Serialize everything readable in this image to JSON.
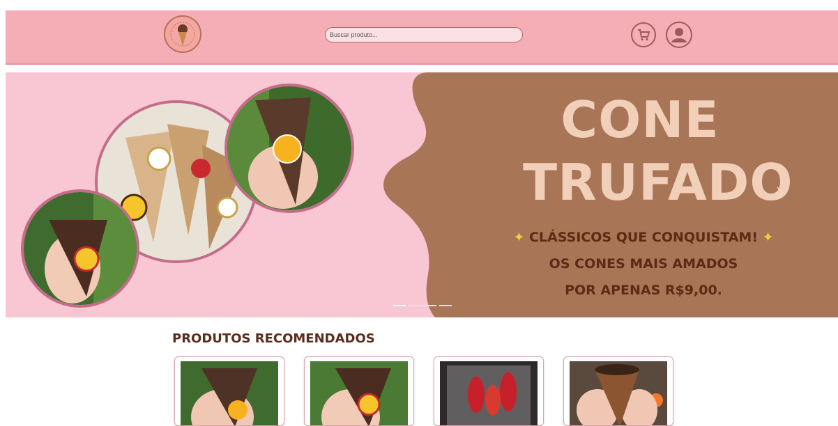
{
  "header": {
    "search": {
      "placeholder": "Buscar produto...",
      "value": ""
    },
    "cart_icon": "cart-icon",
    "user_icon": "user-icon"
  },
  "banner": {
    "title_line1": "CONE",
    "title_line2": "TRUFADO",
    "subtitle_line1": "CLÁSSICOS QUE CONQUISTAM!",
    "subtitle_line2": "OS CONES MAIS AMADOS",
    "subtitle_line3": "POR APENAS R$9,00.",
    "sparkle": "✦",
    "next_icon": "chevron-right-icon",
    "slides": 3,
    "active_slide": 1
  },
  "products": {
    "section_title": "PRODUTOS RECOMENDADOS"
  },
  "colors": {
    "header_bg": "#f6aeb6",
    "banner_pink": "#f9c6d4",
    "banner_brown": "#a97557",
    "title_cream": "#f1cfb8",
    "text_brown": "#5e2a14"
  }
}
